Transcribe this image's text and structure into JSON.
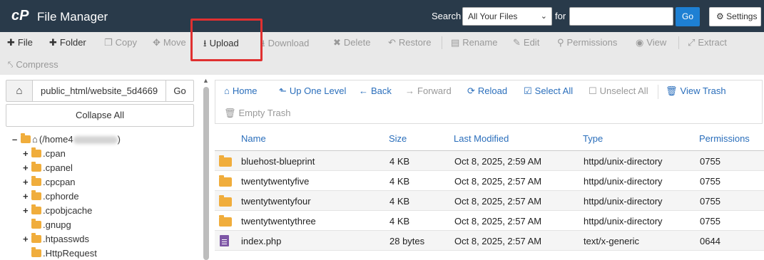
{
  "header": {
    "logo": "cP",
    "title": "File Manager",
    "search_label": "Search",
    "search_scope": "All Your Files",
    "for_label": "for",
    "search_value": "",
    "go_label": "Go",
    "settings_label": "Settings"
  },
  "toolbar": {
    "file": "File",
    "folder": "Folder",
    "copy": "Copy",
    "move": "Move",
    "upload": "Upload",
    "download": "Download",
    "delete": "Delete",
    "restore": "Restore",
    "rename": "Rename",
    "edit": "Edit",
    "permissions": "Permissions",
    "view": "View",
    "extract": "Extract",
    "compress": "Compress"
  },
  "sidebar": {
    "path_value": "public_html/website_5d4669",
    "go_label": "Go",
    "collapse_label": "Collapse All",
    "root_prefix": "(/home4",
    "root_suffix": ")",
    "tree": [
      {
        "label": ".cpan",
        "toggle": "+"
      },
      {
        "label": ".cpanel",
        "toggle": "+"
      },
      {
        "label": ".cpcpan",
        "toggle": "+"
      },
      {
        "label": ".cphorde",
        "toggle": "+"
      },
      {
        "label": ".cpobjcache",
        "toggle": "+"
      },
      {
        "label": ".gnupg",
        "toggle": ""
      },
      {
        "label": ".htpasswds",
        "toggle": "+"
      },
      {
        "label": ".HttpRequest",
        "toggle": ""
      }
    ]
  },
  "nav": {
    "home": "Home",
    "up": "Up One Level",
    "back": "Back",
    "forward": "Forward",
    "reload": "Reload",
    "select_all": "Select All",
    "unselect_all": "Unselect All",
    "view_trash": "View Trash",
    "empty_trash": "Empty Trash"
  },
  "table": {
    "columns": [
      "Name",
      "Size",
      "Last Modified",
      "Type",
      "Permissions"
    ],
    "rows": [
      {
        "kind": "folder",
        "name": "bluehost-blueprint",
        "size": "4 KB",
        "modified": "Oct 8, 2025, 2:59 AM",
        "type": "httpd/unix-directory",
        "perms": "0755"
      },
      {
        "kind": "folder",
        "name": "twentytwentyfive",
        "size": "4 KB",
        "modified": "Oct 8, 2025, 2:57 AM",
        "type": "httpd/unix-directory",
        "perms": "0755"
      },
      {
        "kind": "folder",
        "name": "twentytwentyfour",
        "size": "4 KB",
        "modified": "Oct 8, 2025, 2:57 AM",
        "type": "httpd/unix-directory",
        "perms": "0755"
      },
      {
        "kind": "folder",
        "name": "twentytwentythree",
        "size": "4 KB",
        "modified": "Oct 8, 2025, 2:57 AM",
        "type": "httpd/unix-directory",
        "perms": "0755"
      },
      {
        "kind": "file",
        "name": "index.php",
        "size": "28 bytes",
        "modified": "Oct 8, 2025, 2:57 AM",
        "type": "text/x-generic",
        "perms": "0644"
      }
    ]
  },
  "colors": {
    "header_bg": "#293a4a",
    "accent_blue": "#2a6ebb",
    "go_button": "#1e80d3",
    "folder": "#f0ad3c",
    "highlight_box": "#e03030"
  }
}
